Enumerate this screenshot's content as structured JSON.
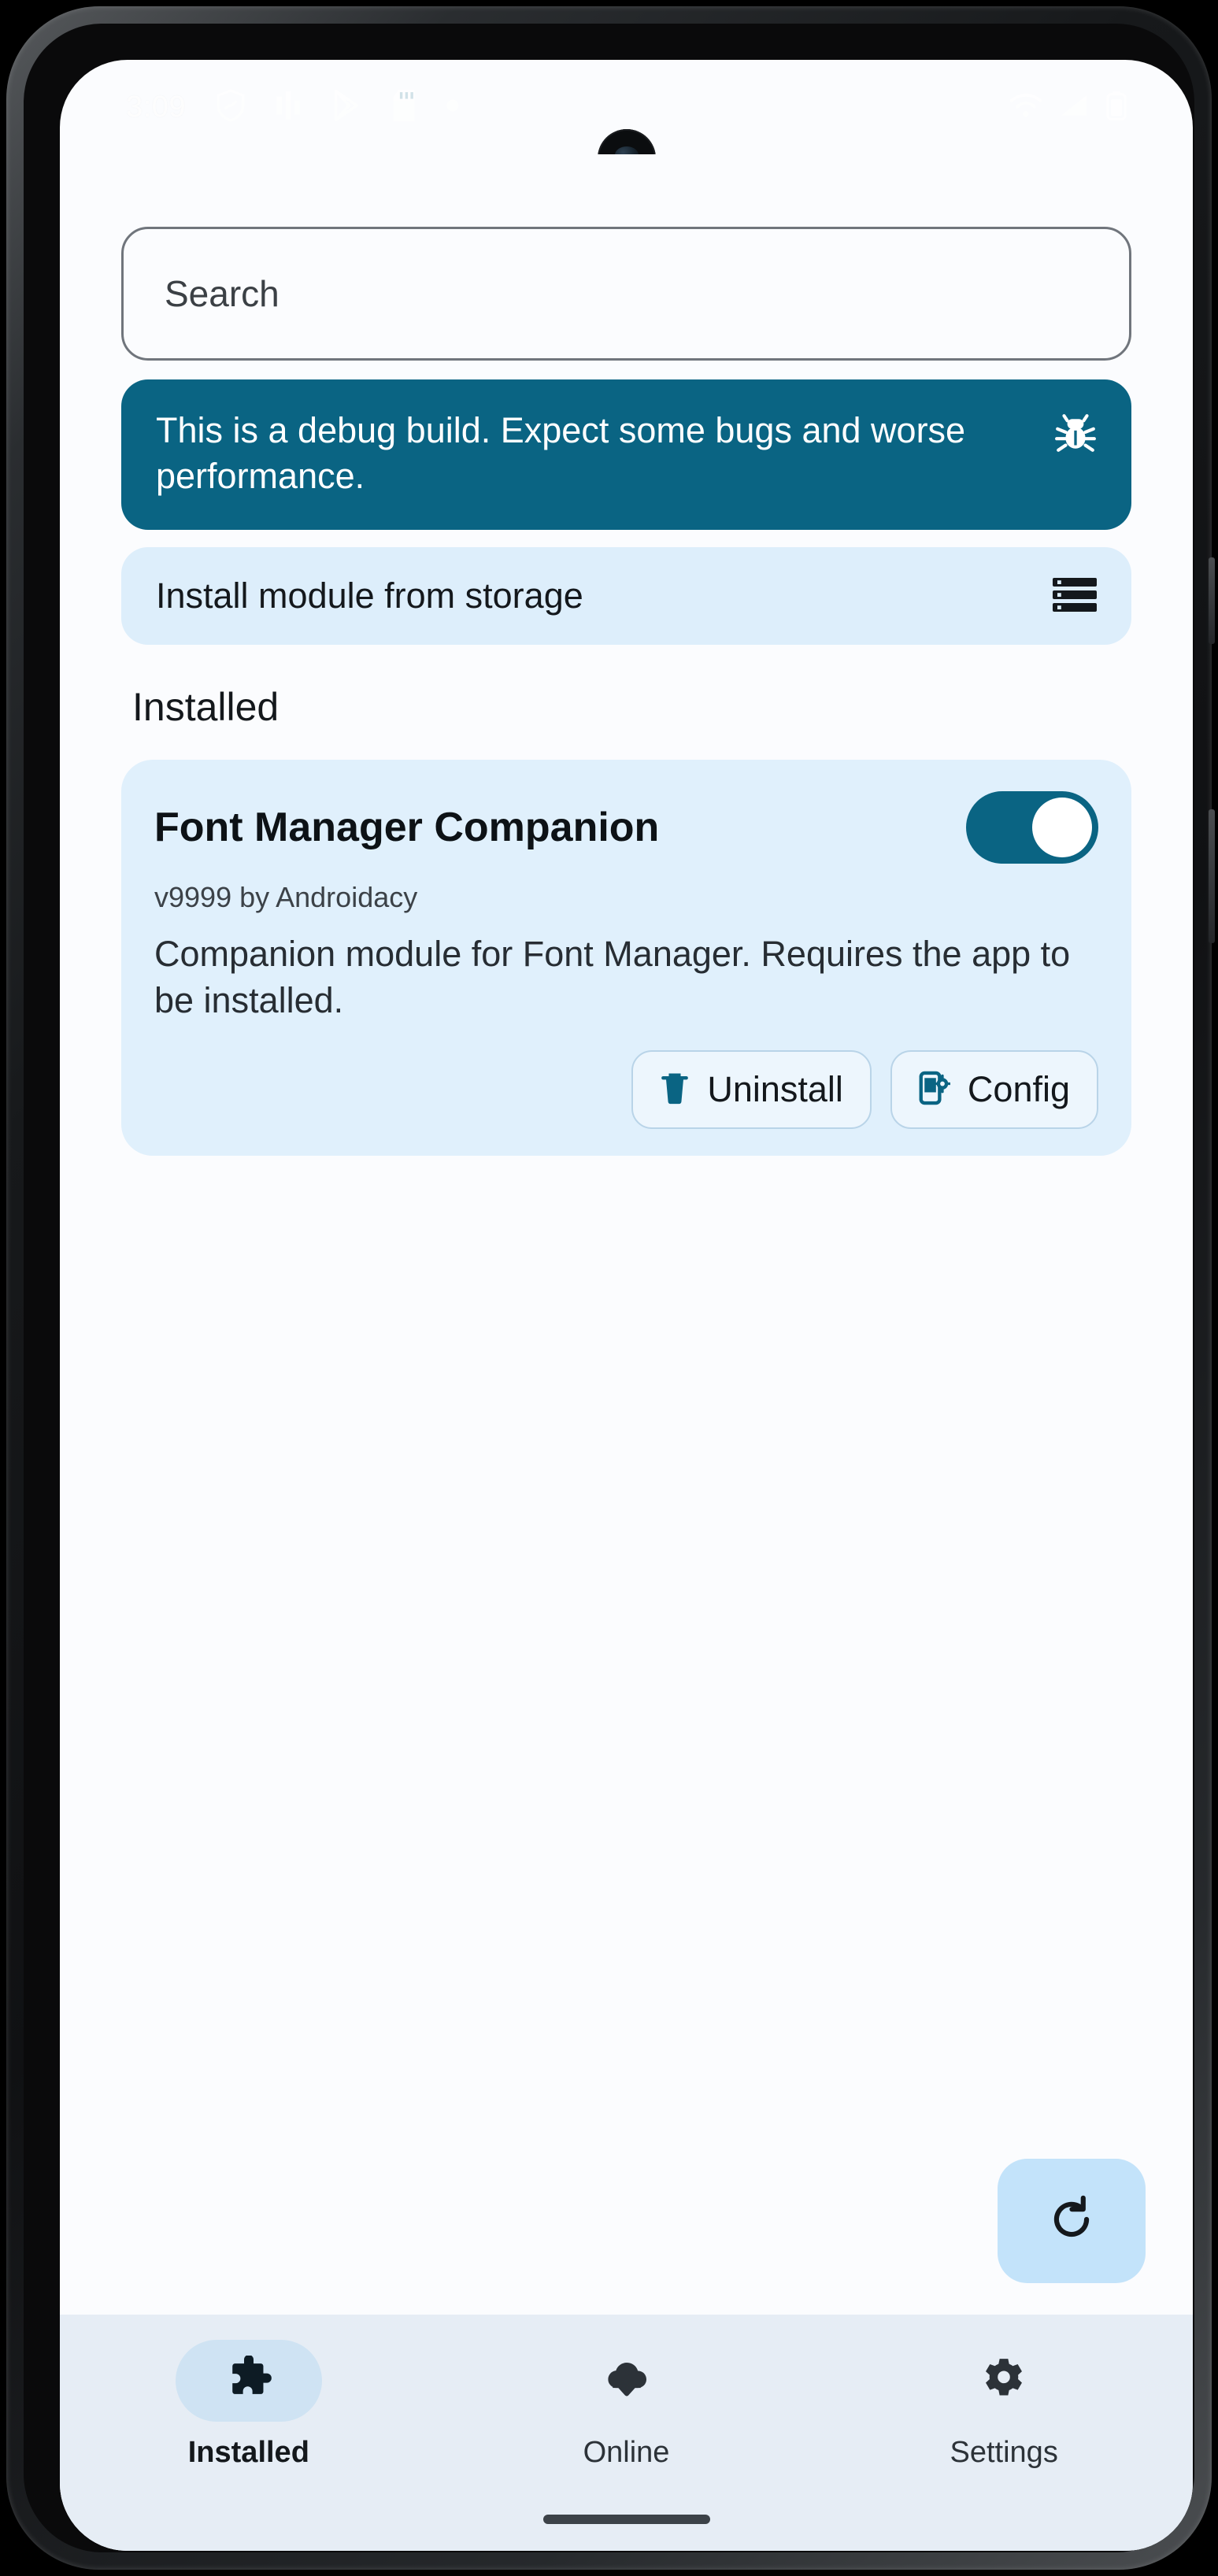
{
  "device": {
    "status_bar": {
      "clock": "3:09",
      "left_icons": [
        "shield-icon",
        "equalizer-icon",
        "play-store-icon",
        "sd-card-icon",
        "dot-icon"
      ],
      "right_icons": [
        "wifi-icon",
        "signal-icon",
        "battery-icon"
      ]
    },
    "gesture_bar": "home-indicator"
  },
  "colors": {
    "accent_teal": "#0A6483",
    "card_blue": "#E0F0FC",
    "row_blue": "#DDEEFB",
    "nav_bg": "#E6EDF5",
    "nav_pill_active": "#CFE3F3",
    "fab_bg": "#C3E3FA",
    "screen_bg": "#FBFCFE"
  },
  "search": {
    "placeholder": "Search",
    "value": ""
  },
  "debug_banner": {
    "text": "This is a debug build. Expect some bugs and worse performance.",
    "icon": "bug-icon"
  },
  "install_row": {
    "label": "Install module from storage",
    "icon": "storage-list-icon"
  },
  "sections": {
    "installed_title": "Installed"
  },
  "modules": [
    {
      "name": "Font Manager Companion",
      "meta": "v9999 by Androidacy",
      "description": "Companion module for Font Manager. Requires the app to be installed.",
      "enabled": true,
      "actions": [
        {
          "label": "Uninstall",
          "icon": "trash-icon"
        },
        {
          "label": "Config",
          "icon": "config-phone-icon"
        }
      ]
    }
  ],
  "fab": {
    "icon": "refresh-icon",
    "label": "Refresh"
  },
  "bottom_nav": {
    "items": [
      {
        "label": "Installed",
        "icon": "puzzle-icon",
        "active": true
      },
      {
        "label": "Online",
        "icon": "cloud-download-icon",
        "active": false
      },
      {
        "label": "Settings",
        "icon": "gear-icon",
        "active": false
      }
    ]
  }
}
